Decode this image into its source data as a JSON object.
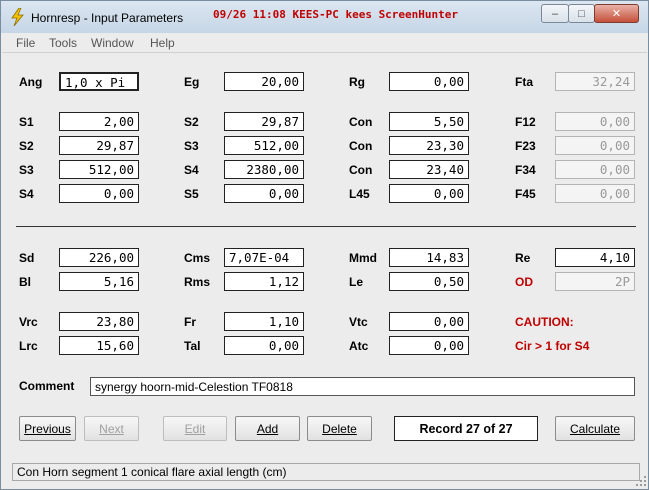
{
  "window": {
    "title": "Hornresp - Input Parameters",
    "screenhunter_text": "09/26 11:08 KEES-PC kees ScreenHunter",
    "minimize_glyph": "–",
    "maximize_glyph": "□",
    "close_glyph": "✕"
  },
  "menu": [
    "File",
    "Tools",
    "Window",
    "Help"
  ],
  "params": {
    "ang": {
      "label": "Ang",
      "value": "1,0 x Pi"
    },
    "eg": {
      "label": "Eg",
      "value": "20,00"
    },
    "rg": {
      "label": "Rg",
      "value": "0,00"
    },
    "fta": {
      "label": "Fta",
      "value": "32,24"
    },
    "s1": {
      "label": "S1",
      "value": "2,00"
    },
    "s2a": {
      "label": "S2",
      "value": "29,87"
    },
    "con1": {
      "label": "Con",
      "value": "5,50"
    },
    "f12": {
      "label": "F12",
      "value": "0,00"
    },
    "s2b": {
      "label": "S2",
      "value": "29,87"
    },
    "s3a": {
      "label": "S3",
      "value": "512,00"
    },
    "con2": {
      "label": "Con",
      "value": "23,30"
    },
    "f23": {
      "label": "F23",
      "value": "0,00"
    },
    "s3b": {
      "label": "S3",
      "value": "512,00"
    },
    "s4a": {
      "label": "S4",
      "value": "2380,00"
    },
    "con3": {
      "label": "Con",
      "value": "23,40"
    },
    "f34": {
      "label": "F34",
      "value": "0,00"
    },
    "s4b": {
      "label": "S4",
      "value": "0,00"
    },
    "s5": {
      "label": "S5",
      "value": "0,00"
    },
    "l45": {
      "label": "L45",
      "value": "0,00"
    },
    "f45": {
      "label": "F45",
      "value": "0,00"
    },
    "sd": {
      "label": "Sd",
      "value": "226,00"
    },
    "cms": {
      "label": "Cms",
      "value": "7,07E-04"
    },
    "mmd": {
      "label": "Mmd",
      "value": "14,83"
    },
    "re": {
      "label": "Re",
      "value": "4,10"
    },
    "bl": {
      "label": "Bl",
      "value": "5,16"
    },
    "rms": {
      "label": "Rms",
      "value": "1,12"
    },
    "le": {
      "label": "Le",
      "value": "0,50"
    },
    "od": {
      "label": "OD",
      "value": "2P"
    },
    "vrc": {
      "label": "Vrc",
      "value": "23,80"
    },
    "fr": {
      "label": "Fr",
      "value": "1,10"
    },
    "vtc": {
      "label": "Vtc",
      "value": "0,00"
    },
    "lrc": {
      "label": "Lrc",
      "value": "15,60"
    },
    "tal": {
      "label": "Tal",
      "value": "0,00"
    },
    "atc": {
      "label": "Atc",
      "value": "0,00"
    }
  },
  "caution": {
    "title": "CAUTION:",
    "message": "Cir > 1 for S4"
  },
  "comment": {
    "label": "Comment",
    "value": "synergy hoorn-mid-Celestion TF0818"
  },
  "buttons": {
    "previous": "Previous",
    "next": "Next",
    "edit": "Edit",
    "add": "Add",
    "delete": "Delete",
    "calculate": "Calculate"
  },
  "record": "Record 27 of 27",
  "status": "Con  Horn segment 1 conical flare axial length  (cm)",
  "colors": {
    "caution_red": "#c00000",
    "screenhunter_red": "#c00000",
    "background": "#ececec"
  }
}
